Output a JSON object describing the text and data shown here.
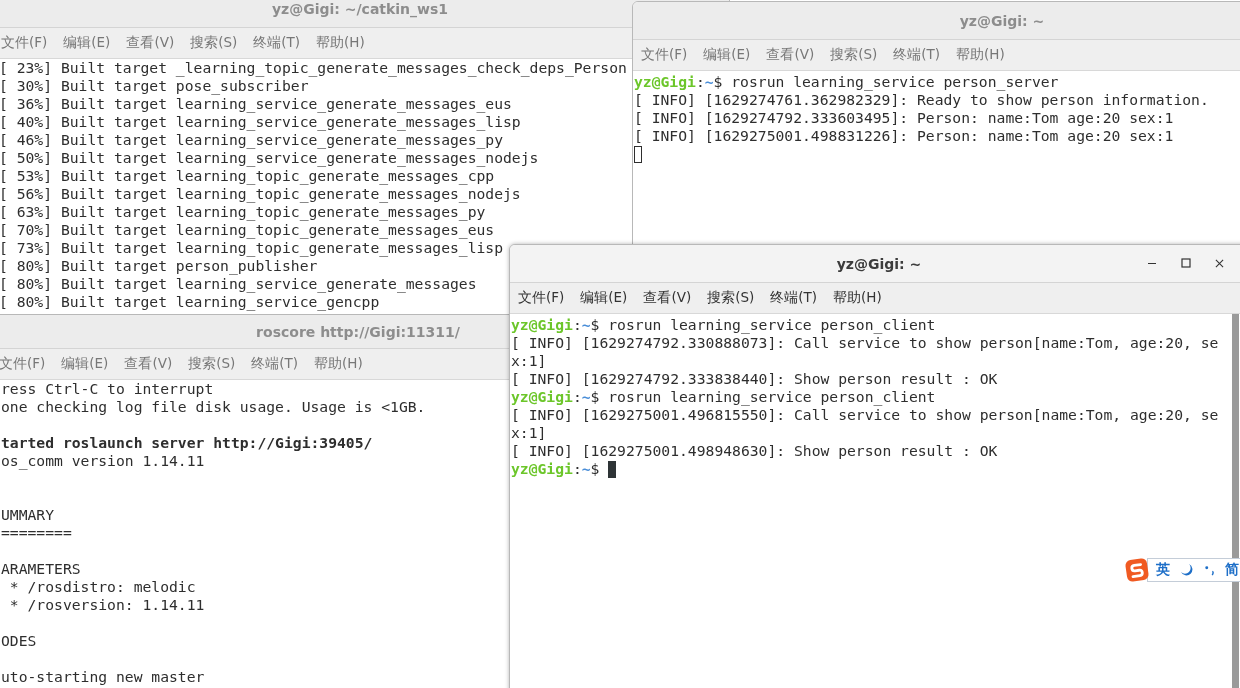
{
  "windows": [
    {
      "title": "yz@Gigi: ~/catkin_ws1",
      "active": false,
      "menu": [
        "文件(F)",
        "编辑(E)",
        "查看(V)",
        "搜索(S)",
        "终端(T)",
        "帮助(H)"
      ],
      "lines": [
        {
          "kind": "text",
          "text": "[ 23%] Built target _learning_topic_generate_messages_check_deps_Person"
        },
        {
          "kind": "text",
          "text": "[ 30%] Built target pose_subscriber"
        },
        {
          "kind": "text",
          "text": "[ 36%] Built target learning_service_generate_messages_eus"
        },
        {
          "kind": "text",
          "text": "[ 40%] Built target learning_service_generate_messages_lisp"
        },
        {
          "kind": "text",
          "text": "[ 46%] Built target learning_service_generate_messages_py"
        },
        {
          "kind": "text",
          "text": "[ 50%] Built target learning_service_generate_messages_nodejs"
        },
        {
          "kind": "text",
          "text": "[ 53%] Built target learning_topic_generate_messages_cpp"
        },
        {
          "kind": "text",
          "text": "[ 56%] Built target learning_topic_generate_messages_nodejs"
        },
        {
          "kind": "text",
          "text": "[ 63%] Built target learning_topic_generate_messages_py"
        },
        {
          "kind": "text",
          "text": "[ 70%] Built target learning_topic_generate_messages_eus"
        },
        {
          "kind": "text",
          "text": "[ 73%] Built target learning_topic_generate_messages_lisp"
        },
        {
          "kind": "text",
          "text": "[ 80%] Built target person_publisher"
        },
        {
          "kind": "text",
          "text": "[ 80%] Built target learning_service_generate_messages"
        },
        {
          "kind": "text",
          "text": "[ 80%] Built target learning_service_gencpp"
        }
      ]
    },
    {
      "title": "yz@Gigi: ~",
      "active": false,
      "menu": [
        "文件(F)",
        "编辑(E)",
        "查看(V)",
        "搜索(S)",
        "终端(T)",
        "帮助(H)"
      ],
      "lines": [
        {
          "kind": "prompt",
          "user": "yz@Gigi",
          "sep": ":",
          "path": "~",
          "command": "$ rosrun learning_service person_server"
        },
        {
          "kind": "text",
          "text": "[ INFO] [1629274761.362982329]: Ready to show person information."
        },
        {
          "kind": "text",
          "text": "[ INFO] [1629274792.333603495]: Person: name:Tom age:20 sex:1"
        },
        {
          "kind": "text",
          "text": "[ INFO] [1629275001.498831226]: Person: name:Tom age:20 sex:1"
        },
        {
          "kind": "blank",
          "cursor": true
        }
      ]
    },
    {
      "title": "roscore http://Gigi:11311/",
      "active": false,
      "menu": [
        "文件(F)",
        "编辑(E)",
        "查看(V)",
        "搜索(S)",
        "终端(T)",
        "帮助(H)"
      ],
      "lines": [
        {
          "kind": "text",
          "text": "ress Ctrl-C to interrupt"
        },
        {
          "kind": "text",
          "text": "one checking log file disk usage. Usage is <1GB."
        },
        {
          "kind": "blank"
        },
        {
          "kind": "text",
          "text": "tarted roslaunch server http://Gigi:39405/",
          "bold": true
        },
        {
          "kind": "text",
          "text": "os_comm version 1.14.11"
        },
        {
          "kind": "blank"
        },
        {
          "kind": "blank"
        },
        {
          "kind": "text",
          "text": "UMMARY"
        },
        {
          "kind": "text",
          "text": "========"
        },
        {
          "kind": "blank"
        },
        {
          "kind": "text",
          "text": "ARAMETERS"
        },
        {
          "kind": "text",
          "text": " * /rosdistro: melodic"
        },
        {
          "kind": "text",
          "text": " * /rosversion: 1.14.11"
        },
        {
          "kind": "blank"
        },
        {
          "kind": "text",
          "text": "ODES"
        },
        {
          "kind": "blank"
        },
        {
          "kind": "text",
          "text": "uto-starting new master"
        }
      ]
    },
    {
      "title": "yz@Gigi: ~",
      "active": true,
      "menu": [
        "文件(F)",
        "编辑(E)",
        "查看(V)",
        "搜索(S)",
        "终端(T)",
        "帮助(H)"
      ],
      "lines": [
        {
          "kind": "prompt",
          "user": "yz@Gigi",
          "sep": ":",
          "path": "~",
          "command": "$ rosrun learning_service person_client"
        },
        {
          "kind": "text",
          "text": "[ INFO] [1629274792.330888073]: Call service to show person[name:Tom, age:20, se"
        },
        {
          "kind": "text",
          "text": "x:1]"
        },
        {
          "kind": "text",
          "text": "[ INFO] [1629274792.333838440]: Show person result : OK"
        },
        {
          "kind": "prompt",
          "user": "yz@Gigi",
          "sep": ":",
          "path": "~",
          "command": "$ rosrun learning_service person_client"
        },
        {
          "kind": "text",
          "text": "[ INFO] [1629275001.496815550]: Call service to show person[name:Tom, age:20, se"
        },
        {
          "kind": "text",
          "text": "x:1]"
        },
        {
          "kind": "text",
          "text": "[ INFO] [1629275001.498948630]: Show person result : OK"
        },
        {
          "kind": "prompt",
          "user": "yz@Gigi",
          "sep": ":",
          "path": "~",
          "command": "$",
          "cursor": true
        }
      ]
    }
  ],
  "ime_bar": {
    "labels": [
      "英",
      "简"
    ]
  }
}
